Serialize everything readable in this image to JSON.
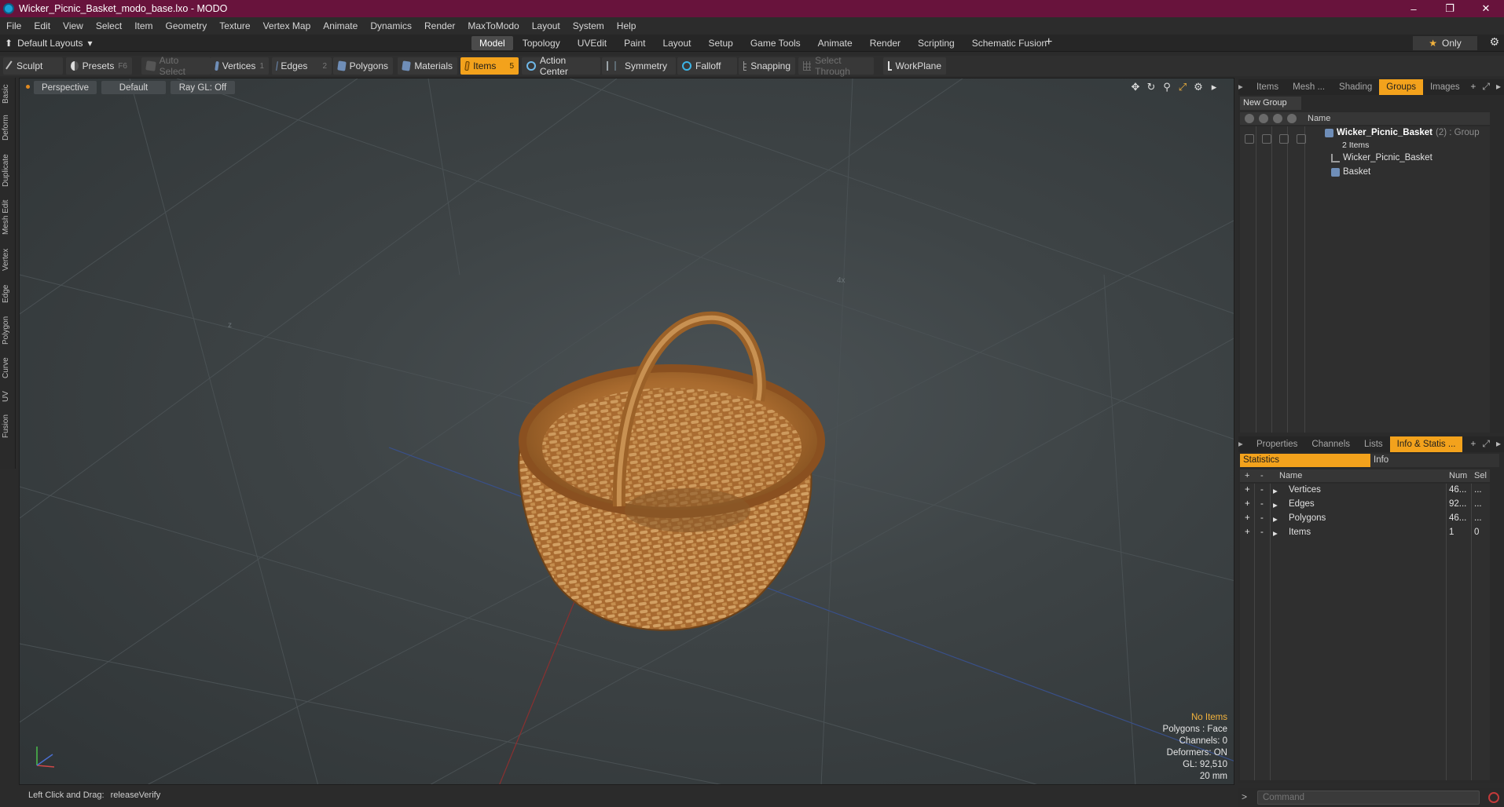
{
  "window": {
    "title": "Wicker_Picnic_Basket_modo_base.lxo - MODO",
    "controls": [
      "–",
      "❐",
      "✕"
    ]
  },
  "menu": [
    "File",
    "Edit",
    "View",
    "Select",
    "Item",
    "Geometry",
    "Texture",
    "Vertex Map",
    "Animate",
    "Dynamics",
    "Render",
    "MaxToModo",
    "Layout",
    "System",
    "Help"
  ],
  "layoutbar": {
    "layout_label": "Default Layouts",
    "tabs": [
      "Model",
      "Topology",
      "UVEdit",
      "Paint",
      "Layout",
      "Setup",
      "Game Tools",
      "Animate",
      "Render",
      "Scripting",
      "Schematic Fusion"
    ],
    "active_tab": "Model",
    "only_label": "Only"
  },
  "toolbar": {
    "sculpt": "Sculpt",
    "presets": "Presets",
    "presets_key": "F6",
    "auto_select": "Auto Select",
    "vertices": "Vertices",
    "vertices_key": "1",
    "edges": "Edges",
    "edges_key": "2",
    "polygons": "Polygons",
    "materials": "Materials",
    "items": "Items",
    "items_key": "5",
    "action_center": "Action Center",
    "symmetry": "Symmetry",
    "falloff": "Falloff",
    "snapping": "Snapping",
    "select_through": "Select Through",
    "workplane": "WorkPlane"
  },
  "left_tabs": [
    "Basic",
    "Deform",
    "Duplicate",
    "Mesh Edit",
    "Vertex",
    "Edge",
    "Polygon",
    "Curve",
    "UV",
    "Fusion"
  ],
  "viewport": {
    "view": "Perspective",
    "shading": "Default",
    "raygl": "Ray GL: Off",
    "info": {
      "no_items": "No Items",
      "polygons": "Polygons : Face",
      "channels": "Channels: 0",
      "deformers": "Deformers: ON",
      "gl": "GL: 92,510",
      "scale": "20 mm"
    }
  },
  "statusbar": {
    "hint": "Left Click and Drag:",
    "action": "releaseVerify"
  },
  "groups_panel": {
    "tabs": [
      "Items",
      "Mesh ...",
      "Shading",
      "Groups",
      "Images"
    ],
    "active_tab": "Groups",
    "new_group": "New Group",
    "col_name": "Name",
    "group": {
      "name": "Wicker_Picnic_Basket",
      "suffix": "(2) : Group",
      "count": "2 Items"
    },
    "children": [
      "Wicker_Picnic_Basket",
      "Basket"
    ]
  },
  "stats_panel": {
    "tabs": [
      "Properties",
      "Channels",
      "Lists",
      "Info & Statis ..."
    ],
    "active_tab": "Info & Statis ...",
    "subtabs": {
      "statistics": "Statistics",
      "info": "Info"
    },
    "columns": {
      "plus": "+",
      "minus": "-",
      "name": "Name",
      "num": "Num",
      "sel": "Sel"
    },
    "rows": [
      {
        "name": "Vertices",
        "num": "46...",
        "sel": "..."
      },
      {
        "name": "Edges",
        "num": "92...",
        "sel": "..."
      },
      {
        "name": "Polygons",
        "num": "46...",
        "sel": "..."
      },
      {
        "name": "Items",
        "num": "1",
        "sel": "0"
      }
    ]
  },
  "command": {
    "placeholder": "Command"
  }
}
